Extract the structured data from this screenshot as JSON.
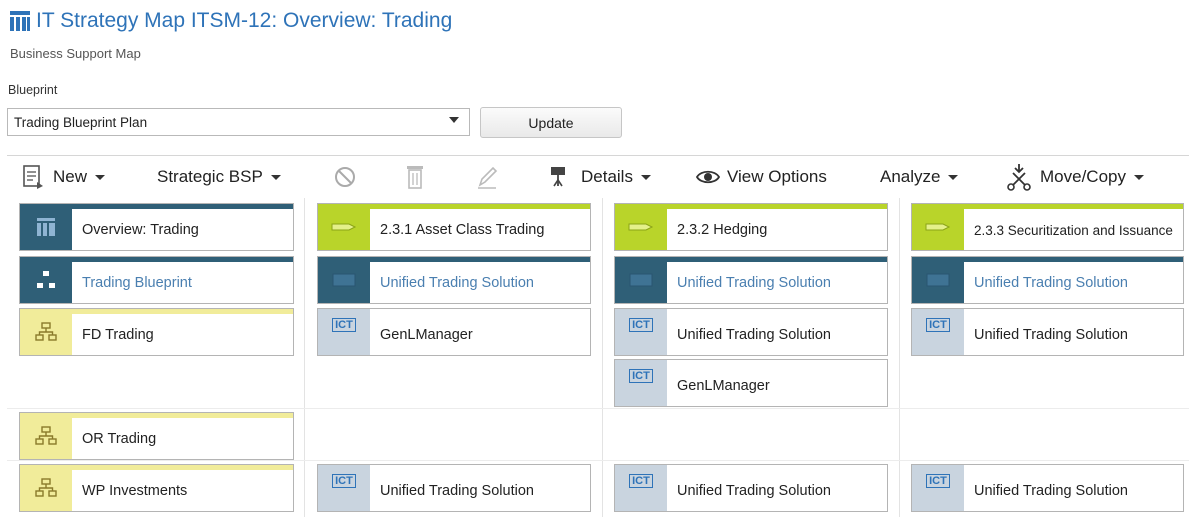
{
  "header": {
    "title": "IT Strategy Map ITSM-12: Overview: Trading",
    "subtitle": "Business Support Map"
  },
  "blueprint": {
    "label": "Blueprint",
    "selected": "Trading Blueprint Plan",
    "update_label": "Update"
  },
  "toolbar": {
    "new_label": "New",
    "strategic_label": "Strategic BSP",
    "details_label": "Details",
    "view_options_label": "View Options",
    "analyze_label": "Analyze",
    "move_copy_label": "Move/Copy"
  },
  "grid": {
    "row1": [
      "Overview: Trading",
      "2.3.1 Asset Class Trading",
      "2.3.2 Hedging",
      "2.3.3 Securitization and Issuance"
    ],
    "row2": [
      "Trading Blueprint",
      "Unified Trading Solution",
      "Unified Trading Solution",
      "Unified Trading Solution"
    ],
    "row3": [
      "FD Trading",
      "GenLManager",
      "Unified Trading Solution",
      "Unified Trading Solution"
    ],
    "row3_extra": "GenLManager",
    "row4": [
      "OR Trading"
    ],
    "row5": [
      "WP Investments",
      "Unified Trading Solution",
      "Unified Trading Solution",
      "Unified Trading Solution"
    ]
  },
  "icons": {
    "ict_badge": "ICT",
    "blueprint_icon": "blueprint-icon",
    "org_icon": "org-chart-icon",
    "tag_icon": "tag-icon",
    "map_icon": "strategy-map-icon"
  },
  "colors": {
    "title_blue": "#2e73b8",
    "dark_teal": "#2f5f77",
    "lime": "#b9d42a",
    "pale_yellow": "#f1ec9a",
    "ict_side": "#c9d4df",
    "link": "#4a7fb0"
  }
}
